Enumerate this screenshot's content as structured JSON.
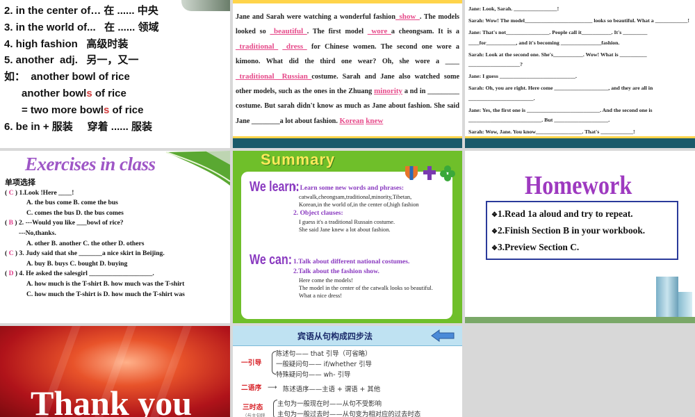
{
  "tile1": {
    "lines": [
      {
        "before": "2. in the center of… 在 ...... 中央",
        "red": "",
        "after": ""
      },
      {
        "before": "3. in the world of...   在 ...... 领域",
        "red": "",
        "after": ""
      },
      {
        "before": "4. high fashion   高级时装",
        "red": "",
        "after": ""
      },
      {
        "before": "5. another  adj.   另一，又一",
        "red": "",
        "after": ""
      },
      {
        "before": "如：  another bowl of rice",
        "red": "",
        "after": ""
      },
      {
        "before": "      another bowl",
        "red": "s",
        "after": " of rice"
      },
      {
        "before": "      = two more bowl",
        "red": "s",
        "after": " of rice"
      },
      {
        "before": "6. be in + 服装     穿着 ...... 服装",
        "red": "",
        "after": ""
      }
    ]
  },
  "tile2": {
    "t1": "Jane and Sarah were watching a wonderful  fashion",
    "a1": "_show_",
    "t2": ". The models looked so",
    "a2": "_beautiful_",
    "t3": ". The first model",
    "a3": "_wore_",
    "t4": "a cheongsam. It is a",
    "a4": "_traditional_",
    "t5": "",
    "a5": "_dress_",
    "t6": "for Chinese women. The second one wore a kimono.  What did the third one wear?  Oh,  she wore a ____",
    "a6": "_traditional__Russian_",
    "t7": "costume. Sarah and Jane also watched some other models, such as the ones in the Zhuang",
    "a7": "minority",
    "t8": "a nd in _________ costume. But sarah didn't know as much as Jane about fashion. She said Jane ________a lot about fashion.",
    "a8": "Korean",
    "a9": "knew"
  },
  "tile3": {
    "lines": [
      "Jane:   Look, Sarah. ________________!",
      "Sarah: Wow! The model_________________________ looks so beautiful. What a ____________!",
      "Jane:   That's not________________. People call it___________. It's _________ ____for___________, and it's becoming _______________fashion.",
      "Sarah: Look at the second one. She's___________. Wow! What is __________ ___________________?",
      "Jane:   I guess ____________________________.",
      "Sarah: Oh, you are right. Here come ____________________, and they are all in ________________________.",
      "Jane:   Yes, the first one is ___________________________. And the second one is ___________________________. But ____________________.",
      "Sarah:  Wow, Jane. You know_________________. That's ____________!"
    ]
  },
  "tile4": {
    "title": "Exercises in class",
    "heading": "单项选择",
    "q1": {
      "mark": "C",
      "text": "1.Look !Here ____!",
      "opts": "A. the bus come         B. come the bus",
      "opts2": "C. comes the bus     D. the bus comes"
    },
    "q2": {
      "mark": "B",
      "text": "2. ---Would you like ___bowl of rice?",
      "sub": "---No,thanks.",
      "opts": "A. other  B. another  C. the other  D. others"
    },
    "q3": {
      "mark": "C",
      "text": "3. Judy said that she _______a  nice skirt in Beijing.",
      "opts": "A. buy   B. buys   C. bought    D. buying"
    },
    "q4": {
      "mark": "D",
      "text": "4. He asked the salesgirl ___________________.",
      "opts": "A. how much is the T-shirt    B. how much was the T-shirt",
      "opts2": "C. how much the T-shirt is     D. how much the T-shirt was"
    }
  },
  "tile5": {
    "title": "Summary",
    "learn_label": "We learn:",
    "can_label": "We can:",
    "learn": [
      {
        "head": "1. Learn some new words and phrases:",
        "lines": [
          "catwalk,cheongsam,traditional,minority,Tibetan,",
          "Korean,in the world of,in the center of,high fashion"
        ]
      },
      {
        "head": "2. Object clauses:",
        "lines": [
          "I guess it's a traditional Russain costume.",
          "She said Jane knew a lot about fashion."
        ]
      }
    ],
    "can": [
      {
        "head": "1.Talk about different national costumes.",
        "lines": []
      },
      {
        "head": "2.Talk about the fashion show.",
        "lines": [
          "Here come the models!",
          "The model in the center of the catwalk looks so beautiful.",
          "What a nice dress!"
        ]
      }
    ]
  },
  "tile6": {
    "title": "Homework",
    "items": [
      "1.Read 1a aloud and try to repeat.",
      "2.Finish Section B in your workbook.",
      "3.Preview Section C."
    ]
  },
  "tile7": {
    "text": "Thank you"
  },
  "tile8": {
    "title": "宾语从句构成四步法",
    "step1": "一引导",
    "s1a": "陈述句—— that  引导（可省略）",
    "s1b": "一般疑问句—— if/whether 引导",
    "s1c": "特殊疑问句—— wh- 引导",
    "step2": "二语序",
    "s2": "陈述语序——主语 + 谓语 + 其他",
    "step3": "三时态",
    "step3_note": "（与主句呼",
    "s3a": "主句为一般现在时——从句不受影响",
    "s3b": "主句为一般过去时——从句变为相对应的过去时态"
  },
  "colors": {
    "answer_pink": "#e64a8a",
    "purple": "#9e3ac0",
    "summary_green": "#6fbf2a"
  }
}
